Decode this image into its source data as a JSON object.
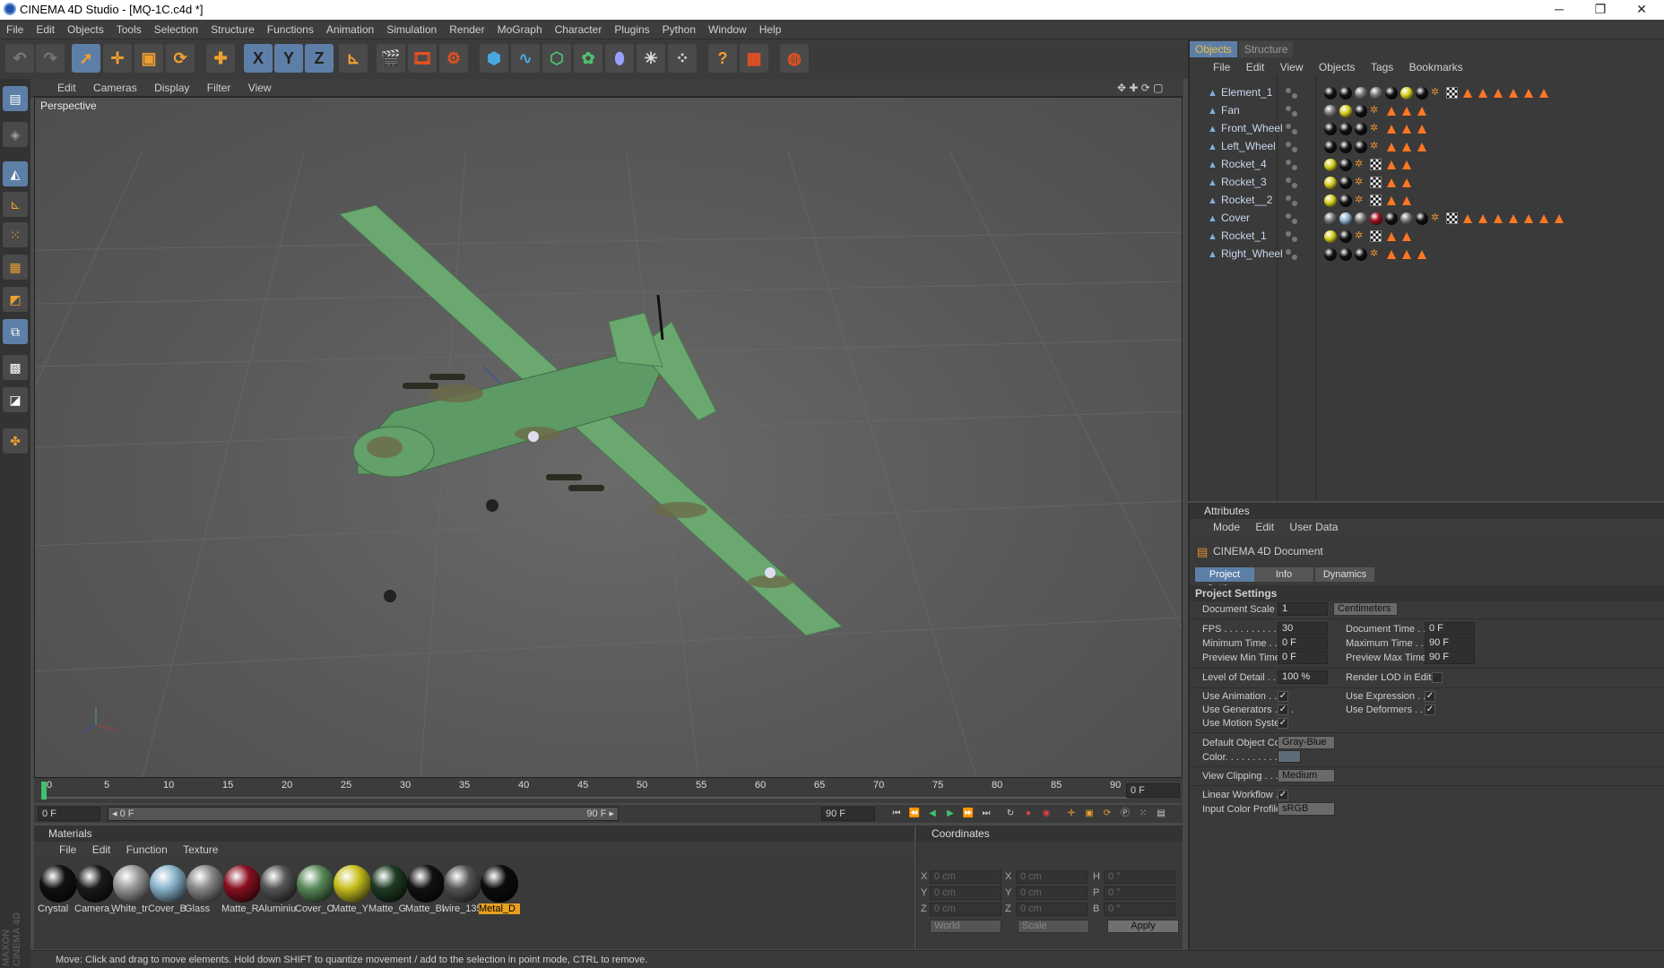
{
  "window": {
    "title": "CINEMA 4D Studio - [MQ-1C.c4d *]",
    "min": "─",
    "max": "❐",
    "close": "✕"
  },
  "menu": [
    "File",
    "Edit",
    "Objects",
    "Tools",
    "Selection",
    "Structure",
    "Functions",
    "Animation",
    "Simulation",
    "Render",
    "MoGraph",
    "Character",
    "Plugins",
    "Python",
    "Window",
    "Help"
  ],
  "viewport": {
    "menu": [
      "Edit",
      "Cameras",
      "Display",
      "Filter",
      "View"
    ],
    "label": "Perspective",
    "nav_icons": "✥ ✚ ⟳ ▢"
  },
  "timeline": {
    "ticks": [
      "0",
      "5",
      "10",
      "15",
      "20",
      "25",
      "30",
      "35",
      "40",
      "45",
      "50",
      "55",
      "60",
      "65",
      "70",
      "75",
      "80",
      "85",
      "90"
    ],
    "current_frame": "0 F",
    "start_field": "0 F",
    "slider_start": "◂ 0 F",
    "slider_end": "90 F ▸",
    "end_field": "90 F"
  },
  "materials": {
    "title": "Materials",
    "menu": [
      "File",
      "Edit",
      "Function",
      "Texture"
    ],
    "items": [
      {
        "label": "Crystal",
        "color": "#111"
      },
      {
        "label": "Camera_",
        "color": "#1a1a1a"
      },
      {
        "label": "White_tr",
        "color": "#999"
      },
      {
        "label": "Cover_B",
        "color": "#8ab4cc"
      },
      {
        "label": "Glass",
        "color": "#888"
      },
      {
        "label": "Matte_R",
        "color": "#8a1020"
      },
      {
        "label": "Aluminiu",
        "color": "#555"
      },
      {
        "label": "Cover_C",
        "color": "#5a8a5a"
      },
      {
        "label": "Matte_Y",
        "color": "#c8c020"
      },
      {
        "label": "Matte_G",
        "color": "#1e3a22"
      },
      {
        "label": "Matte_Bl",
        "color": "#111"
      },
      {
        "label": "wire_135",
        "color": "#555"
      },
      {
        "label": "Metal_D",
        "color": "#0c0c0c"
      }
    ]
  },
  "coordinates": {
    "title": "Coordinates",
    "rows": [
      {
        "a": "X",
        "av": "0 cm",
        "b": "X",
        "bv": "0 cm",
        "c": "H",
        "cv": "0 °"
      },
      {
        "a": "Y",
        "av": "0 cm",
        "b": "Y",
        "bv": "0 cm",
        "c": "P",
        "cv": "0 °"
      },
      {
        "a": "Z",
        "av": "0 cm",
        "b": "Z",
        "bv": "0 cm",
        "c": "B",
        "cv": "0 °"
      }
    ],
    "world": "World",
    "scale": "Scale",
    "apply": "Apply"
  },
  "status": "Move: Click and drag to move elements. Hold down SHIFT to quantize movement / add to the selection in point mode, CTRL to remove.",
  "objects": {
    "tabs": [
      "Objects",
      "Structure"
    ],
    "menu": [
      "File",
      "Edit",
      "View",
      "Objects",
      "Tags",
      "Bookmarks"
    ],
    "items": [
      "Element_1",
      "Fan",
      "Front_Wheel",
      "Left_Wheel",
      "Rocket_4",
      "Rocket_3",
      "Rocket__2",
      "Cover",
      "Rocket_1",
      "Right_Wheel"
    ]
  },
  "attributes": {
    "title": "Attributes",
    "menu": [
      "Mode",
      "Edit",
      "User Data"
    ],
    "doc": "CINEMA 4D Document",
    "tabs": [
      "Project Settings",
      "Info",
      "Dynamics"
    ],
    "section": "Project Settings",
    "document_scale_label": "Document Scale . .",
    "document_scale": "1",
    "units": "Centimeters",
    "fps_label": "FPS . . . . . . . . . . . .",
    "fps": "30",
    "doc_time_label": "Document Time . . . .",
    "doc_time": "0 F",
    "min_time_label": "Minimum Time . . . .",
    "min_time": "0 F",
    "max_time_label": "Maximum Time . . . .",
    "max_time": "90 F",
    "prev_min_label": "Preview Min Time . .",
    "prev_min": "0 F",
    "prev_max_label": "Preview Max Time . .",
    "prev_max": "90 F",
    "lod_label": "Level of Detail . . . .",
    "lod": "100 %",
    "render_lod_label": "Render LOD in Editor",
    "use_anim_label": "Use Animation . . . .",
    "use_expr_label": "Use Expression . . .",
    "use_gen_label": "Use Generators . . . .",
    "use_def_label": "Use Deformers . . . .",
    "use_motion_label": "Use Motion System",
    "def_color_label": "Default Object Color",
    "def_color": "Gray-Blue",
    "color_label": "Color. . . . . . . . . . .",
    "view_clip_label": "View Clipping . . . . .",
    "view_clip": "Medium",
    "linear_label": "Linear Workflow . . .",
    "input_profile_label": "Input Color Profile . .",
    "input_profile": "sRGB",
    "check": "✓"
  },
  "toolbar_axes": [
    "X",
    "Y",
    "Z"
  ],
  "brand": "MAXON CINEMA 4D"
}
